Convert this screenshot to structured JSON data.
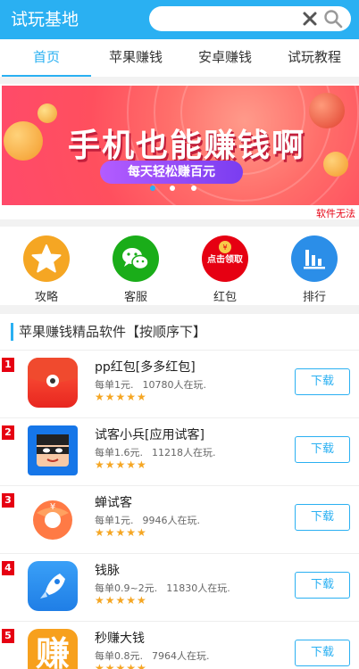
{
  "header": {
    "brand": "试玩基地",
    "search": {
      "placeholder": ""
    }
  },
  "tabs": [
    {
      "label": "首页",
      "active": true
    },
    {
      "label": "苹果赚钱",
      "active": false
    },
    {
      "label": "安卓赚钱",
      "active": false
    },
    {
      "label": "试玩教程",
      "active": false
    }
  ],
  "banner": {
    "headline": "手机也能赚钱啊",
    "subline": "每天轻松赚百元",
    "active_slide": 1,
    "slide_count": 3,
    "notice": "软件无法"
  },
  "shortcuts": [
    {
      "label": "攻略",
      "icon": "star-icon",
      "color": "#f5a623"
    },
    {
      "label": "客服",
      "icon": "wechat-icon",
      "color": "#1aad19"
    },
    {
      "label": "红包",
      "icon": "red-envelope-icon",
      "color": "#e60012",
      "badge": "点击领取"
    },
    {
      "label": "排行",
      "icon": "bar-chart-icon",
      "color": "#2b8ee8"
    }
  ],
  "section": {
    "title": "苹果赚钱精品软件【按顺序下】"
  },
  "apps": [
    {
      "rank": "1",
      "name": "pp红包[多多红包]",
      "price": "每单1元.",
      "count": "10780人在玩.",
      "stars": "★★★★★",
      "download": "下载",
      "icon": "red-envelope-app-icon"
    },
    {
      "rank": "2",
      "name": "试客小兵[应用试客]",
      "price": "每单1.6元.",
      "count": "11218人在玩.",
      "stars": "★★★★★",
      "download": "下载",
      "icon": "ninja-app-icon"
    },
    {
      "rank": "3",
      "name": "蝉试客",
      "price": "每单1元.",
      "count": "9946人在玩.",
      "stars": "★★★★★",
      "download": "下载",
      "icon": "cicada-app-icon"
    },
    {
      "rank": "4",
      "name": "钱脉",
      "price": "每单0.9~2元.",
      "count": "11830人在玩.",
      "stars": "★★★★★",
      "download": "下载",
      "icon": "rocket-app-icon"
    },
    {
      "rank": "5",
      "name": "秒赚大钱",
      "price": "每单0.8元.",
      "count": "7964人在玩.",
      "stars": "★★★★★",
      "download": "下载",
      "icon": "zhuan-app-icon",
      "glyph": "赚"
    }
  ]
}
